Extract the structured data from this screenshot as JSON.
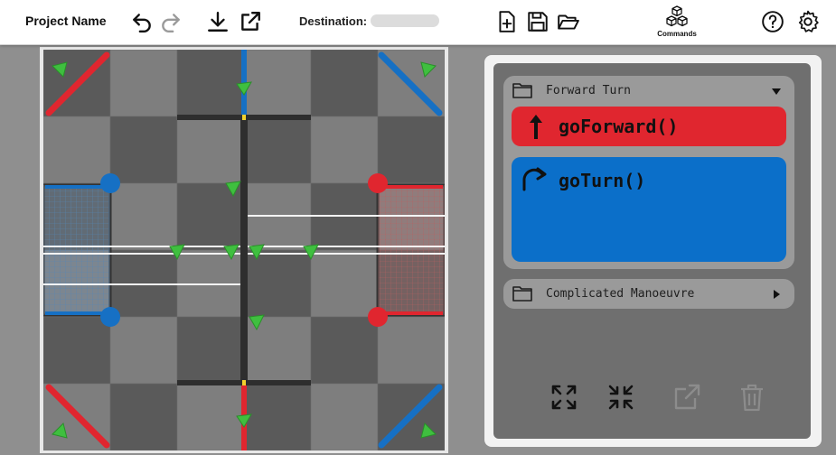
{
  "topbar": {
    "project_name": "Project Name",
    "destination_label": "Destination:",
    "destination_value": "",
    "commands_label": "Commands",
    "icons": [
      "undo-icon",
      "redo-icon",
      "download-icon",
      "export-icon",
      "new-file-icon",
      "save-icon",
      "open-folder-icon",
      "commands-cubes-icon",
      "help-icon",
      "settings-icon"
    ]
  },
  "field": {
    "description_colors": {
      "red": "#e0262f",
      "blue": "#1670c4",
      "green": "#3fbf3f",
      "tile_dark": "#5a5a5a",
      "tile_light": "#7e7e7e"
    }
  },
  "groups": [
    {
      "title": "Forward Turn",
      "expanded": true,
      "commands": [
        {
          "label": "goForward()",
          "icon": "arrow-up-icon",
          "color": "#e0262f"
        },
        {
          "label": "goTurn()",
          "icon": "turn-arrow-icon",
          "color": "#0b6fc9"
        }
      ]
    },
    {
      "title": "Complicated Manoeuvre",
      "expanded": false,
      "commands": []
    }
  ],
  "bottom_tools": [
    "expand-all-icon",
    "collapse-all-icon",
    "open-external-icon",
    "trash-icon"
  ]
}
